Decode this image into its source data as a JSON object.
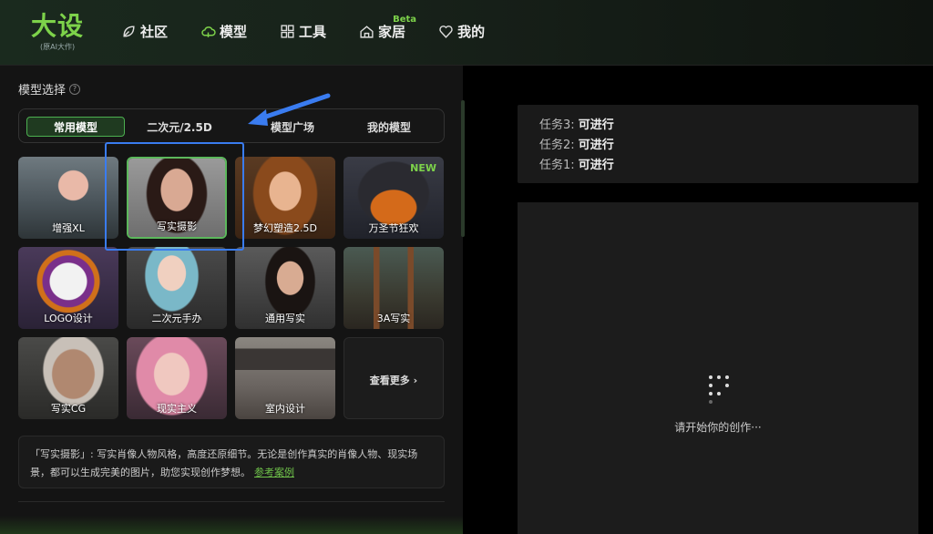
{
  "brand": {
    "name": "大设",
    "tagline": "(原AI大作)"
  },
  "nav": [
    {
      "label": "社区",
      "icon": "leaf-icon"
    },
    {
      "label": "模型",
      "icon": "cloud-icon"
    },
    {
      "label": "工具",
      "icon": "grid-icon"
    },
    {
      "label": "家居",
      "icon": "house-icon",
      "badge": "Beta"
    },
    {
      "label": "我的",
      "icon": "heart-icon"
    }
  ],
  "section": {
    "title": "模型选择",
    "help": "?"
  },
  "tabs": [
    "常用模型",
    "二次元/2.5D",
    "模型广场",
    "我的模型"
  ],
  "models": [
    {
      "label": "增强XL"
    },
    {
      "label": "写实摄影",
      "selected": true
    },
    {
      "label": "梦幻塑造2.5D"
    },
    {
      "label": "万圣节狂欢",
      "badge": "NEW"
    },
    {
      "label": "LOGO设计"
    },
    {
      "label": "二次元手办"
    },
    {
      "label": "通用写实"
    },
    {
      "label": "3A写实"
    },
    {
      "label": "写实CG"
    },
    {
      "label": "现实主义"
    },
    {
      "label": "室内设计"
    }
  ],
  "more": {
    "label": "查看更多"
  },
  "description": {
    "text": "「写实摄影」: 写实肖像人物风格，高度还原细节。无论是创作真实的肖像人物、现实场景，都可以生成完美的图片，助您实现创作梦想。",
    "link": "参考案例"
  },
  "tasks": [
    {
      "label": "任务3: ",
      "status": "可进行"
    },
    {
      "label": "任务2: ",
      "status": "可进行"
    },
    {
      "label": "任务1: ",
      "status": "可进行"
    }
  ],
  "canvas": {
    "hint": "请开始你的创作···"
  },
  "colors": {
    "accent": "#7dd24a",
    "annotation": "#3a7cf0"
  }
}
